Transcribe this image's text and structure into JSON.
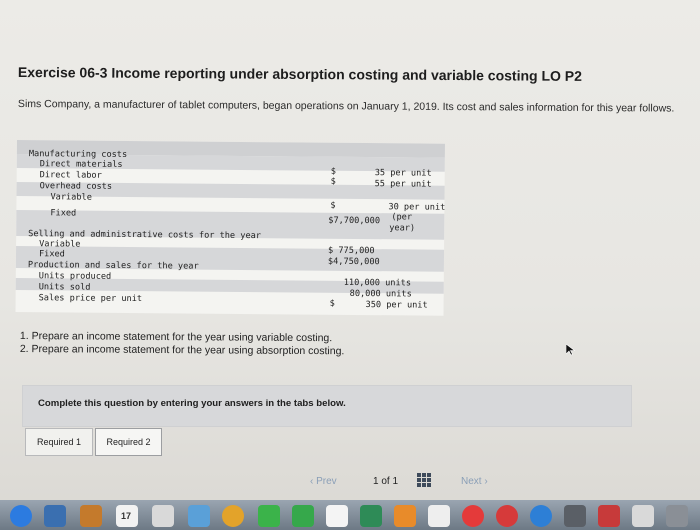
{
  "header": {
    "title": "Exercise 06-3 Income reporting under absorption costing and variable costing LO P2"
  },
  "intro": "Sims Company, a manufacturer of tablet computers, began operations on January 1, 2019. Its cost and sales information for this year follows.",
  "data_table": {
    "manufacturing_costs_label": "Manufacturing costs",
    "direct_materials_label": "Direct materials",
    "direct_materials_dollar": "$",
    "direct_materials_value": "35 per unit",
    "direct_labor_label": "Direct labor",
    "direct_labor_dollar": "$",
    "direct_labor_value": "55 per unit",
    "overhead_label": "Overhead costs",
    "overhead_variable_label": "Variable",
    "overhead_variable_dollar": "$",
    "overhead_variable_value": "30 per unit",
    "overhead_fixed_label": "Fixed",
    "overhead_fixed_value": "$7,700,000",
    "overhead_fixed_per": "(per",
    "overhead_fixed_year": "year)",
    "selling_label": "Selling and administrative costs for the year",
    "selling_variable_label": "Variable",
    "selling_variable_value": "$  775,000",
    "selling_fixed_label": "Fixed",
    "selling_fixed_value": "$4,750,000",
    "production_label": "Production and sales for the year",
    "units_produced_label": "Units produced",
    "units_produced_value": "110,000 units",
    "units_sold_label": "Units sold",
    "units_sold_value": "80,000 units",
    "sales_price_label": "Sales price per unit",
    "sales_price_dollar": "$",
    "sales_price_value": "350 per unit"
  },
  "questions": [
    "1. Prepare an income statement for the year using variable costing.",
    "2. Prepare an income statement for the year using absorption costing."
  ],
  "instruction": "Complete this question by entering your answers in the tabs below.",
  "tabs": [
    {
      "label": "Required 1"
    },
    {
      "label": "Required 2"
    }
  ],
  "pager": {
    "prev": "Prev",
    "page_indicator": "1 of 1",
    "next": "Next"
  },
  "taskbar": {
    "calendar_day": "17"
  },
  "colors": {
    "band": "#d6d7d9",
    "link": "#8a9fb7",
    "taskbar": "#7f8a96"
  }
}
